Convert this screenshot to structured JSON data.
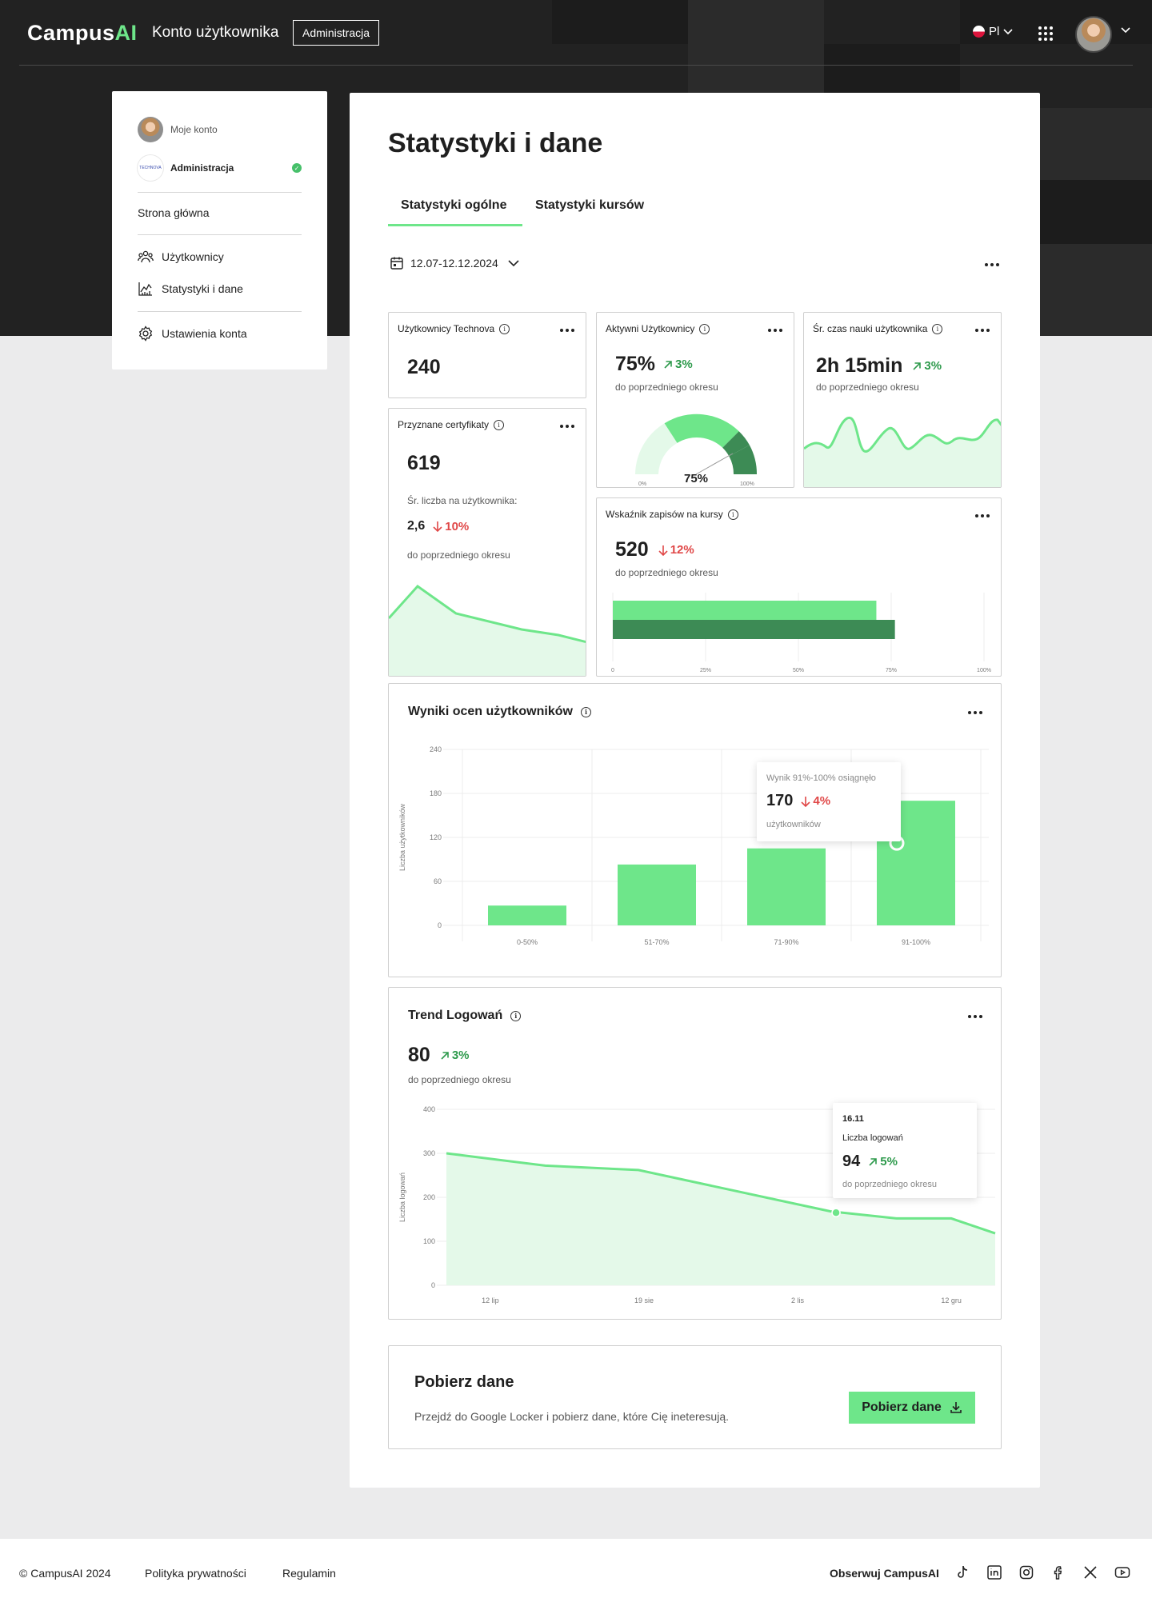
{
  "header": {
    "logo_main": "Campus",
    "logo_accent": "AI",
    "section_title": "Konto użytkownika",
    "admin_chip": "Administracja",
    "language": "Pl"
  },
  "sidebar": {
    "my_account": "Moje konto",
    "organization": "Administracja",
    "org_logo_text": "TECHNOVA",
    "home": "Strona główna",
    "users": "Użytkownicy",
    "stats": "Statystyki i dane",
    "settings": "Ustawienia konta"
  },
  "main": {
    "title": "Statystyki i dane",
    "tabs": [
      "Statystyki ogólne",
      "Statystyki kursów"
    ],
    "date_range": "12.07-12.12.2024"
  },
  "cards": {
    "users": {
      "title": "Użytkownicy Technova",
      "value": "240"
    },
    "certs": {
      "title": "Przyznane certyfikaty",
      "value": "619",
      "avg_label": "Śr. liczba na użytkownika:",
      "avg_value": "2,6",
      "delta": "10%",
      "caption": "do poprzedniego okresu"
    },
    "active": {
      "title": "Aktywni Użytkownicy",
      "value": "75%",
      "delta": "3%",
      "caption": "do poprzedniego okresu",
      "gauge_value": "75%",
      "gauge_min": "0%",
      "gauge_max": "100%"
    },
    "time": {
      "title": "Śr. czas nauki użytkownika",
      "value": "2h 15min",
      "delta": "3%",
      "caption": "do poprzedniego okresu"
    },
    "enroll": {
      "title": "Wskaźnik zapisów na kursy",
      "value": "520",
      "delta": "12%",
      "caption": "do poprzedniego okresu",
      "ticks": [
        "0",
        "25%",
        "50%",
        "75%",
        "100%"
      ]
    }
  },
  "scores": {
    "title": "Wyniki ocen użytkowników",
    "tooltip_title": "Wynik 91%-100% osiągnęło",
    "tooltip_value": "170",
    "tooltip_delta": "4%",
    "tooltip_unit": "użytkowników"
  },
  "logins": {
    "title": "Trend Logowań",
    "value": "80",
    "delta": "3%",
    "caption": "do poprzedniego okresu",
    "tooltip_date": "16.11",
    "tooltip_label": "Liczba logowań",
    "tooltip_value": "94",
    "tooltip_delta": "5%",
    "tooltip_caption": "do poprzedniego okresu"
  },
  "download": {
    "title": "Pobierz dane",
    "description": "Przejdź do Google Locker i pobierz dane, które Cię ineteresują.",
    "button": "Pobierz dane"
  },
  "footer": {
    "copyright": "© CampusAI 2024",
    "privacy": "Polityka prywatności",
    "terms": "Regulamin",
    "follow": "Obserwuj CampusAI"
  },
  "colors": {
    "accent": "#6ee68a",
    "accent_dark": "#3d8b55",
    "up": "#2e9a4c",
    "down": "#e04747",
    "dark_bg": "#222222"
  },
  "chart_data": [
    {
      "type": "bar",
      "title": "Wyniki ocen użytkowników",
      "ylabel": "Liczba użytkowników",
      "categories": [
        "0-50%",
        "51-70%",
        "71-90%",
        "91-100%"
      ],
      "values": [
        27,
        83,
        105,
        170
      ],
      "ylim": [
        0,
        240
      ],
      "yticks": [
        0,
        60,
        120,
        180,
        240
      ]
    },
    {
      "type": "area",
      "title": "Trend Logowań",
      "ylabel": "Liczba logowań",
      "x_tick_labels": [
        "12 lip",
        "19 sie",
        "2 lis",
        "12 gru"
      ],
      "x": [
        0,
        0.18,
        0.35,
        0.7,
        0.82,
        0.92,
        1.0
      ],
      "values": [
        300,
        272,
        262,
        168,
        152,
        152,
        118
      ],
      "ylim": [
        0,
        400
      ],
      "yticks": [
        0,
        100,
        200,
        300,
        400
      ]
    },
    {
      "type": "bar",
      "title": "Wskaźnik zapisów na kursy",
      "orientation": "horizontal",
      "series": [
        {
          "values": [
            71
          ]
        },
        {
          "values": [
            76
          ]
        }
      ],
      "xlim": [
        0,
        100
      ]
    }
  ]
}
